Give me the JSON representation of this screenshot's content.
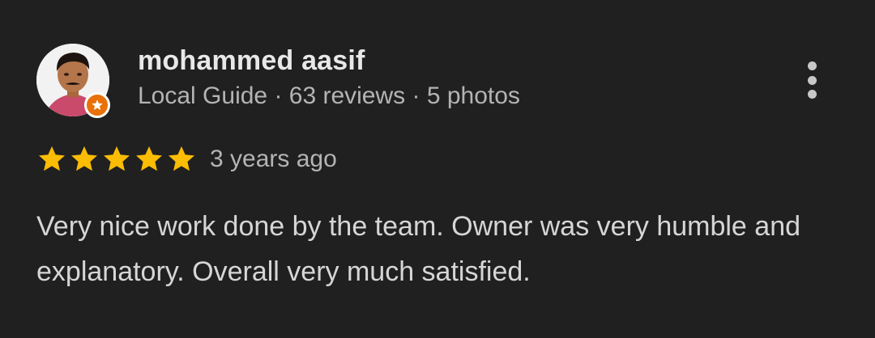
{
  "review": {
    "reviewer_name": "mohammed aasif",
    "reviewer_meta": "Local Guide · 63 reviews · 5 photos",
    "rating": 5,
    "rating_max": 5,
    "time_ago": "3 years ago",
    "text": "Very nice work done by the team. Owner was very humble and explanatory. Overall very much satisfied."
  },
  "icons": {
    "avatar": "profile-photo",
    "badge": "local-guide-star-badge",
    "menu": "more-vert-icon",
    "star": "star-icon"
  },
  "colors": {
    "background": "#202020",
    "star": "#fbbc04",
    "badge": "#e8710a",
    "primary_text": "#e8e8e8",
    "secondary_text": "#b4b4b4"
  }
}
